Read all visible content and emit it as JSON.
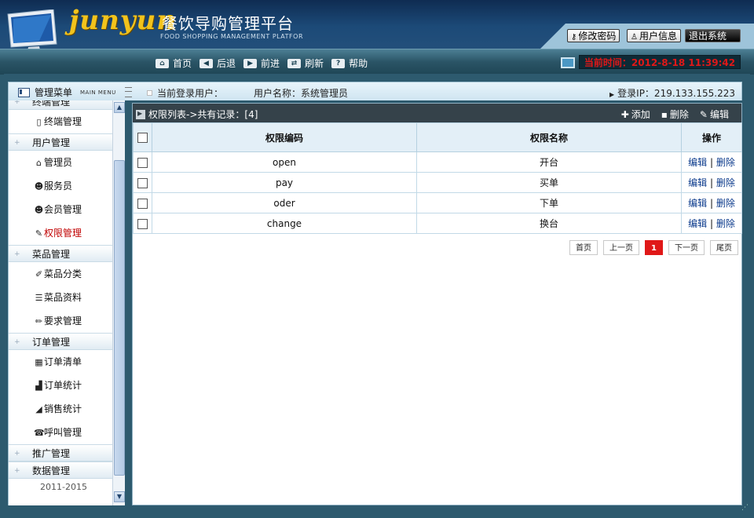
{
  "header": {
    "logo_text": "junyun",
    "title_cn": "餐饮导购管理平台",
    "title_en": "FOOD SHOPPING MANAGEMENT PLATFOR",
    "buttons": {
      "change_password": "修改密码",
      "user_info": "用户信息",
      "logout": "退出系统"
    }
  },
  "nav": {
    "home": "首页",
    "back": "后退",
    "forward": "前进",
    "refresh": "刷新",
    "help": "帮助",
    "current_time": "当前时间：2012-8-18 11:39:42"
  },
  "infobar": {
    "menu_title": "管理菜单",
    "menu_sub": "MAIN MENU",
    "current_user_label": "当前登录用户：",
    "user_name": "用户名称：系统管理员",
    "login_ip": "登录IP：219.133.155.223"
  },
  "sidebar": {
    "cut_top_group": "终端管理",
    "groups": [
      {
        "label": "用户管理",
        "items": [
          {
            "label": "管理员",
            "icon": "home-icon"
          },
          {
            "label": "服务员",
            "icon": "users-icon"
          },
          {
            "label": "会员管理",
            "icon": "member-icon"
          },
          {
            "label": "权限管理",
            "icon": "wrench-icon",
            "active": true
          }
        ]
      },
      {
        "label": "菜品管理",
        "items": [
          {
            "label": "菜品分类",
            "icon": "tag-icon"
          },
          {
            "label": "菜品资料",
            "icon": "list-icon"
          },
          {
            "label": "要求管理",
            "icon": "pencil-icon"
          }
        ]
      },
      {
        "label": "订单管理",
        "items": [
          {
            "label": "订单清单",
            "icon": "calendar-icon"
          },
          {
            "label": "订单统计",
            "icon": "bar-chart-icon"
          },
          {
            "label": "销售统计",
            "icon": "area-chart-icon"
          },
          {
            "label": "呼叫管理",
            "icon": "phone-icon"
          }
        ]
      },
      {
        "label": "推广管理",
        "items": []
      },
      {
        "label": "数据管理",
        "items": []
      }
    ],
    "top_item": {
      "label": "终端管理",
      "icon": "phone-device-icon"
    },
    "year": "2011-2015"
  },
  "main": {
    "list_title": "权限列表->共有记录：[4]",
    "actions": {
      "add": "添加",
      "delete": "删除",
      "edit": "编辑"
    },
    "columns": [
      "权限编码",
      "权限名称",
      "操作"
    ],
    "rows": [
      {
        "code": "open",
        "name": "开台"
      },
      {
        "code": "pay",
        "name": "买单"
      },
      {
        "code": "oder",
        "name": "下单"
      },
      {
        "code": "change",
        "name": "换台"
      }
    ],
    "row_ops": {
      "edit": "编辑",
      "delete": "删除",
      "sep": "|"
    },
    "pager": {
      "first": "首页",
      "prev": "上一页",
      "current": "1",
      "next": "下一页",
      "last": "尾页"
    }
  }
}
